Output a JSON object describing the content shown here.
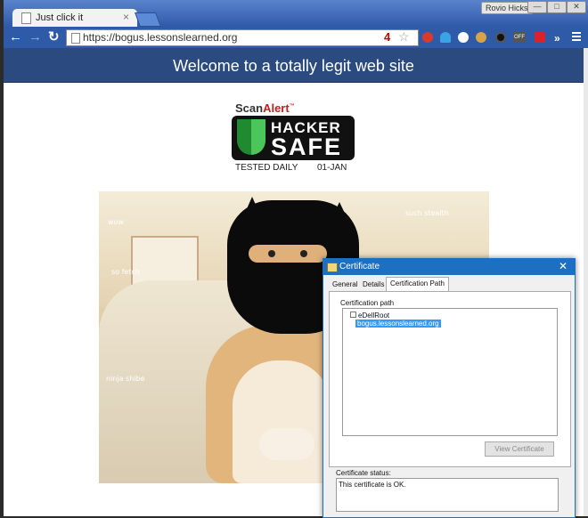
{
  "browser": {
    "tab_title": "Just click it",
    "tab_close": "×",
    "user_name": "Rovio Hicks",
    "window_buttons": [
      "—",
      "□",
      "✕"
    ],
    "url": "https://bogus.lessonslearned.org",
    "omnibox_badge": "4",
    "icons": {
      "back": "arrow-left-icon",
      "forward": "arrow-right-icon",
      "reload": "reload-icon",
      "star": "bookmark-star-icon",
      "menu": "hamburger-menu-icon"
    },
    "extensions": [
      {
        "name": "adblock-icon",
        "color": "#d83a2e"
      },
      {
        "name": "ghostery-icon",
        "color": "#39a3e6"
      },
      {
        "name": "chat-icon",
        "color": "#ffffff"
      },
      {
        "name": "cookie-icon",
        "color": "#d8a24a"
      },
      {
        "name": "circle-icon",
        "color": "#111111"
      },
      {
        "name": "off-toggle-icon",
        "color": "#555555"
      },
      {
        "name": "puzzle-icon",
        "color": "#d8232a"
      }
    ],
    "ext_off_label": "OFF",
    "overflow": "»"
  },
  "page": {
    "header": "Welcome to a totally legit web site",
    "badge": {
      "brand_a": "Scan",
      "brand_b": "Alert",
      "tm": "™",
      "hacker": "HACKER",
      "safe": "SAFE",
      "tested": "TESTED DAILY",
      "date": "01-JAN"
    },
    "captions": [
      "wow",
      "such stealth",
      "so fetch",
      "ninja shibe"
    ]
  },
  "dialog": {
    "title": "Certificate",
    "close": "✕",
    "tabs": [
      "General",
      "Details",
      "Certification Path"
    ],
    "path_label": "Certification path",
    "root": "eDellRoot",
    "leaf": "bogus.lessonslearned.org",
    "view_button": "View Certificate",
    "status_label": "Certificate status:",
    "status_text": "This certificate is OK."
  }
}
